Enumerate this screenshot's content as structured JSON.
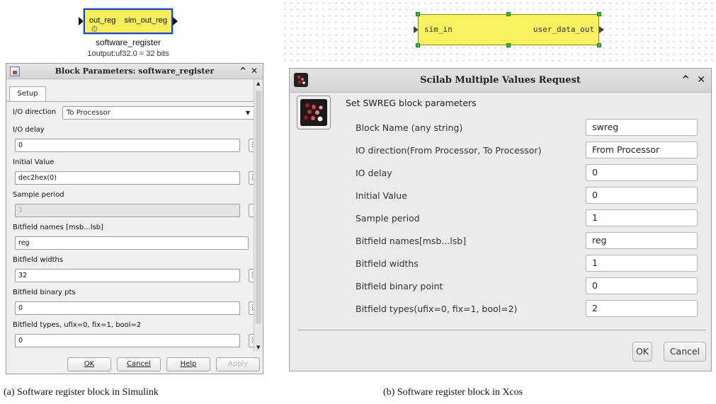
{
  "simulink": {
    "block": {
      "in_port": "out_reg",
      "out_port": "sim_out_reg",
      "name": "software_register",
      "type_info": "1output:uf32.0 = 32 bits",
      "fill": "#f6ef5a",
      "border": "#1f3fd0"
    },
    "dialog": {
      "title": "Block Parameters: software_register",
      "tab": "Setup",
      "io_direction_label": "I/O direction",
      "io_direction_value": "To Processor",
      "fields": [
        {
          "label": "I/O delay",
          "value": "0",
          "disabled": false,
          "dots": true
        },
        {
          "label": "Initial Value",
          "value": "dec2hex(0)",
          "disabled": false,
          "dots": true
        },
        {
          "label": "Sample period",
          "value": "1",
          "disabled": true,
          "dots": true
        },
        {
          "label": "Bitfield names [msb...lsb]",
          "value": "reg",
          "disabled": false,
          "dots": false
        },
        {
          "label": "Bitfield widths",
          "value": "32",
          "disabled": false,
          "dots": true
        },
        {
          "label": "Bitfield binary pts",
          "value": "0",
          "disabled": false,
          "dots": true
        },
        {
          "label": "Bitfield types, ufix=0, fix=1, bool=2",
          "value": "0",
          "disabled": false,
          "dots": true
        }
      ],
      "buttons": {
        "ok": "OK",
        "cancel": "Cancel",
        "help": "Help",
        "apply": "Apply"
      }
    }
  },
  "xcos": {
    "block": {
      "in_port": "sim_in",
      "out_port": "user_data_out",
      "fill": "#f8f25f",
      "handle_color": "#31c431"
    },
    "dialog": {
      "title": "Scilab Multiple Values Request",
      "heading": "Set SWREG block parameters",
      "fields": [
        {
          "label": "Block Name (any string)",
          "value": "swreg"
        },
        {
          "label": "IO direction(From Processor, To Processor)",
          "value": "From Processor"
        },
        {
          "label": "IO delay",
          "value": "0"
        },
        {
          "label": "Initial Value",
          "value": "0"
        },
        {
          "label": "Sample period",
          "value": "1"
        },
        {
          "label": "Bitfield names[msb...lsb]",
          "value": "reg"
        },
        {
          "label": "Bitfield widths",
          "value": "1"
        },
        {
          "label": "Bitfield binary point",
          "value": "0"
        },
        {
          "label": "Bitfield types(ufix=0, fix=1, bool=2)",
          "value": "2"
        }
      ],
      "buttons": {
        "ok": "OK",
        "cancel": "Cancel"
      }
    }
  },
  "captions": {
    "a": "(a) Software register block in Simulink",
    "b": "(b) Software register block in Xcos"
  }
}
